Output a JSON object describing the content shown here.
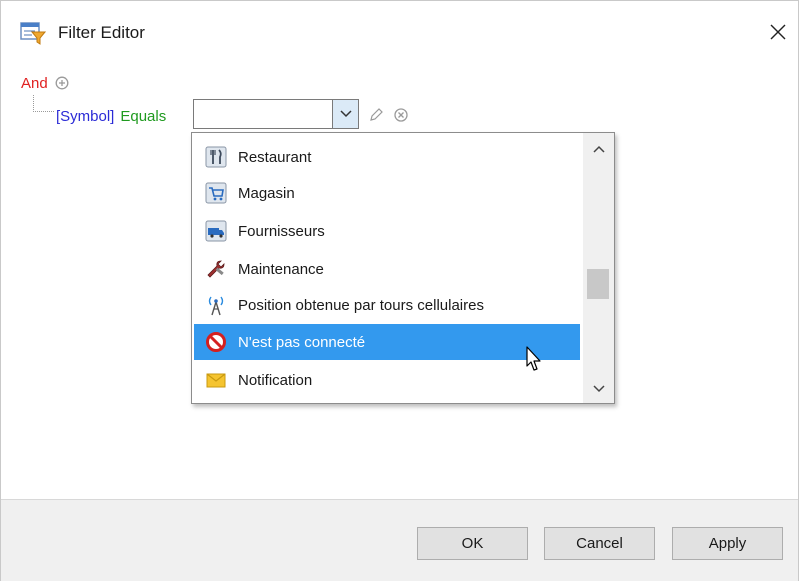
{
  "window": {
    "title": "Filter Editor",
    "close_glyph": "✕"
  },
  "filter": {
    "group_operator": "And",
    "condition": {
      "field": "[Symbol]",
      "operator": "Equals",
      "value": ""
    }
  },
  "dropdown": {
    "items": [
      {
        "label": "Restaurant",
        "icon": "restaurant-icon"
      },
      {
        "label": "Magasin",
        "icon": "shopping-cart-icon"
      },
      {
        "label": "Fournisseurs",
        "icon": "truck-icon"
      },
      {
        "label": "Maintenance",
        "icon": "wrench-icon"
      },
      {
        "label": "Position obtenue par tours cellulaires",
        "icon": "cell-tower-icon"
      },
      {
        "label": "N'est pas connecté",
        "icon": "no-entry-icon",
        "selected": true
      },
      {
        "label": "Notification",
        "icon": "envelope-icon"
      }
    ]
  },
  "buttons": {
    "ok": "OK",
    "cancel": "Cancel",
    "apply": "Apply"
  },
  "colors": {
    "group_operator": "#e02020",
    "field": "#2b2bd6",
    "operator": "#1f9a1f",
    "selection": "#3399ee"
  }
}
